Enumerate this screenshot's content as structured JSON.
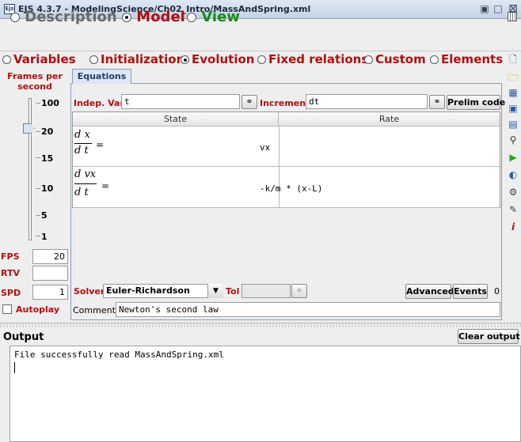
{
  "window": {
    "title": "EJS 4.3.7 - ModelingScience/Ch02_Intro/MassAndSpring.xml",
    "app_icon_text": "Ejs"
  },
  "top_tabs": [
    {
      "label": "Description",
      "selected": false,
      "color": "#6a6a6a"
    },
    {
      "label": "Model",
      "selected": true,
      "color": "#b01010"
    },
    {
      "label": "View",
      "selected": false,
      "color": "#1a8a1a"
    }
  ],
  "model_tabs": [
    {
      "label": "Variables",
      "selected": false
    },
    {
      "label": "Initialization",
      "selected": false
    },
    {
      "label": "Evolution",
      "selected": true
    },
    {
      "label": "Fixed relations",
      "selected": false
    },
    {
      "label": "Custom",
      "selected": false
    },
    {
      "label": "Elements",
      "selected": false
    }
  ],
  "left_panel": {
    "frames_label": "Frames per second",
    "scale_labels": [
      "100",
      "20",
      "15",
      "10",
      "5",
      "1"
    ],
    "slider_value": 20,
    "fps_label": "FPS",
    "fps_value": "20",
    "rtv_label": "RTV",
    "rtv_value": "",
    "spd_label": "SPD",
    "spd_value": "1",
    "autoplay_label": "Autoplay"
  },
  "equations": {
    "tab_label": "Equations",
    "indep_var_label": "Indep. Var.",
    "indep_var_value": "t",
    "increment_label": "Increment",
    "increment_value": "dt",
    "prelim_code_label": "Prelim code",
    "columns": [
      "State",
      "Rate"
    ],
    "rows": [
      {
        "num": "d x",
        "den": "d t",
        "eq": "=",
        "rate": "vx"
      },
      {
        "num": "d vx",
        "den": "d t",
        "eq": "=",
        "rate": "-k/m * (x-L)"
      }
    ],
    "solver_label": "Solver",
    "solver_value": "Euler-Richardson",
    "tol_label": "Tol",
    "tol_value": "",
    "advanced_label": "Advanced",
    "events_label": "Events",
    "events_count": "0",
    "comment_label": "Comment",
    "comment_value": "Newton's second law"
  },
  "output": {
    "label": "Output",
    "clear_label": "Clear output",
    "text": "File successfully read MassAndSpring.xml"
  },
  "icons": {
    "link": "chain-link-icon",
    "toolbar": [
      "new-file-icon",
      "open-folder-icon",
      "open-examples-icon",
      "save-icon",
      "save-as-icon",
      "search-icon",
      "run-icon",
      "web-icon",
      "library-icon",
      "options-icon",
      "info-icon"
    ]
  }
}
